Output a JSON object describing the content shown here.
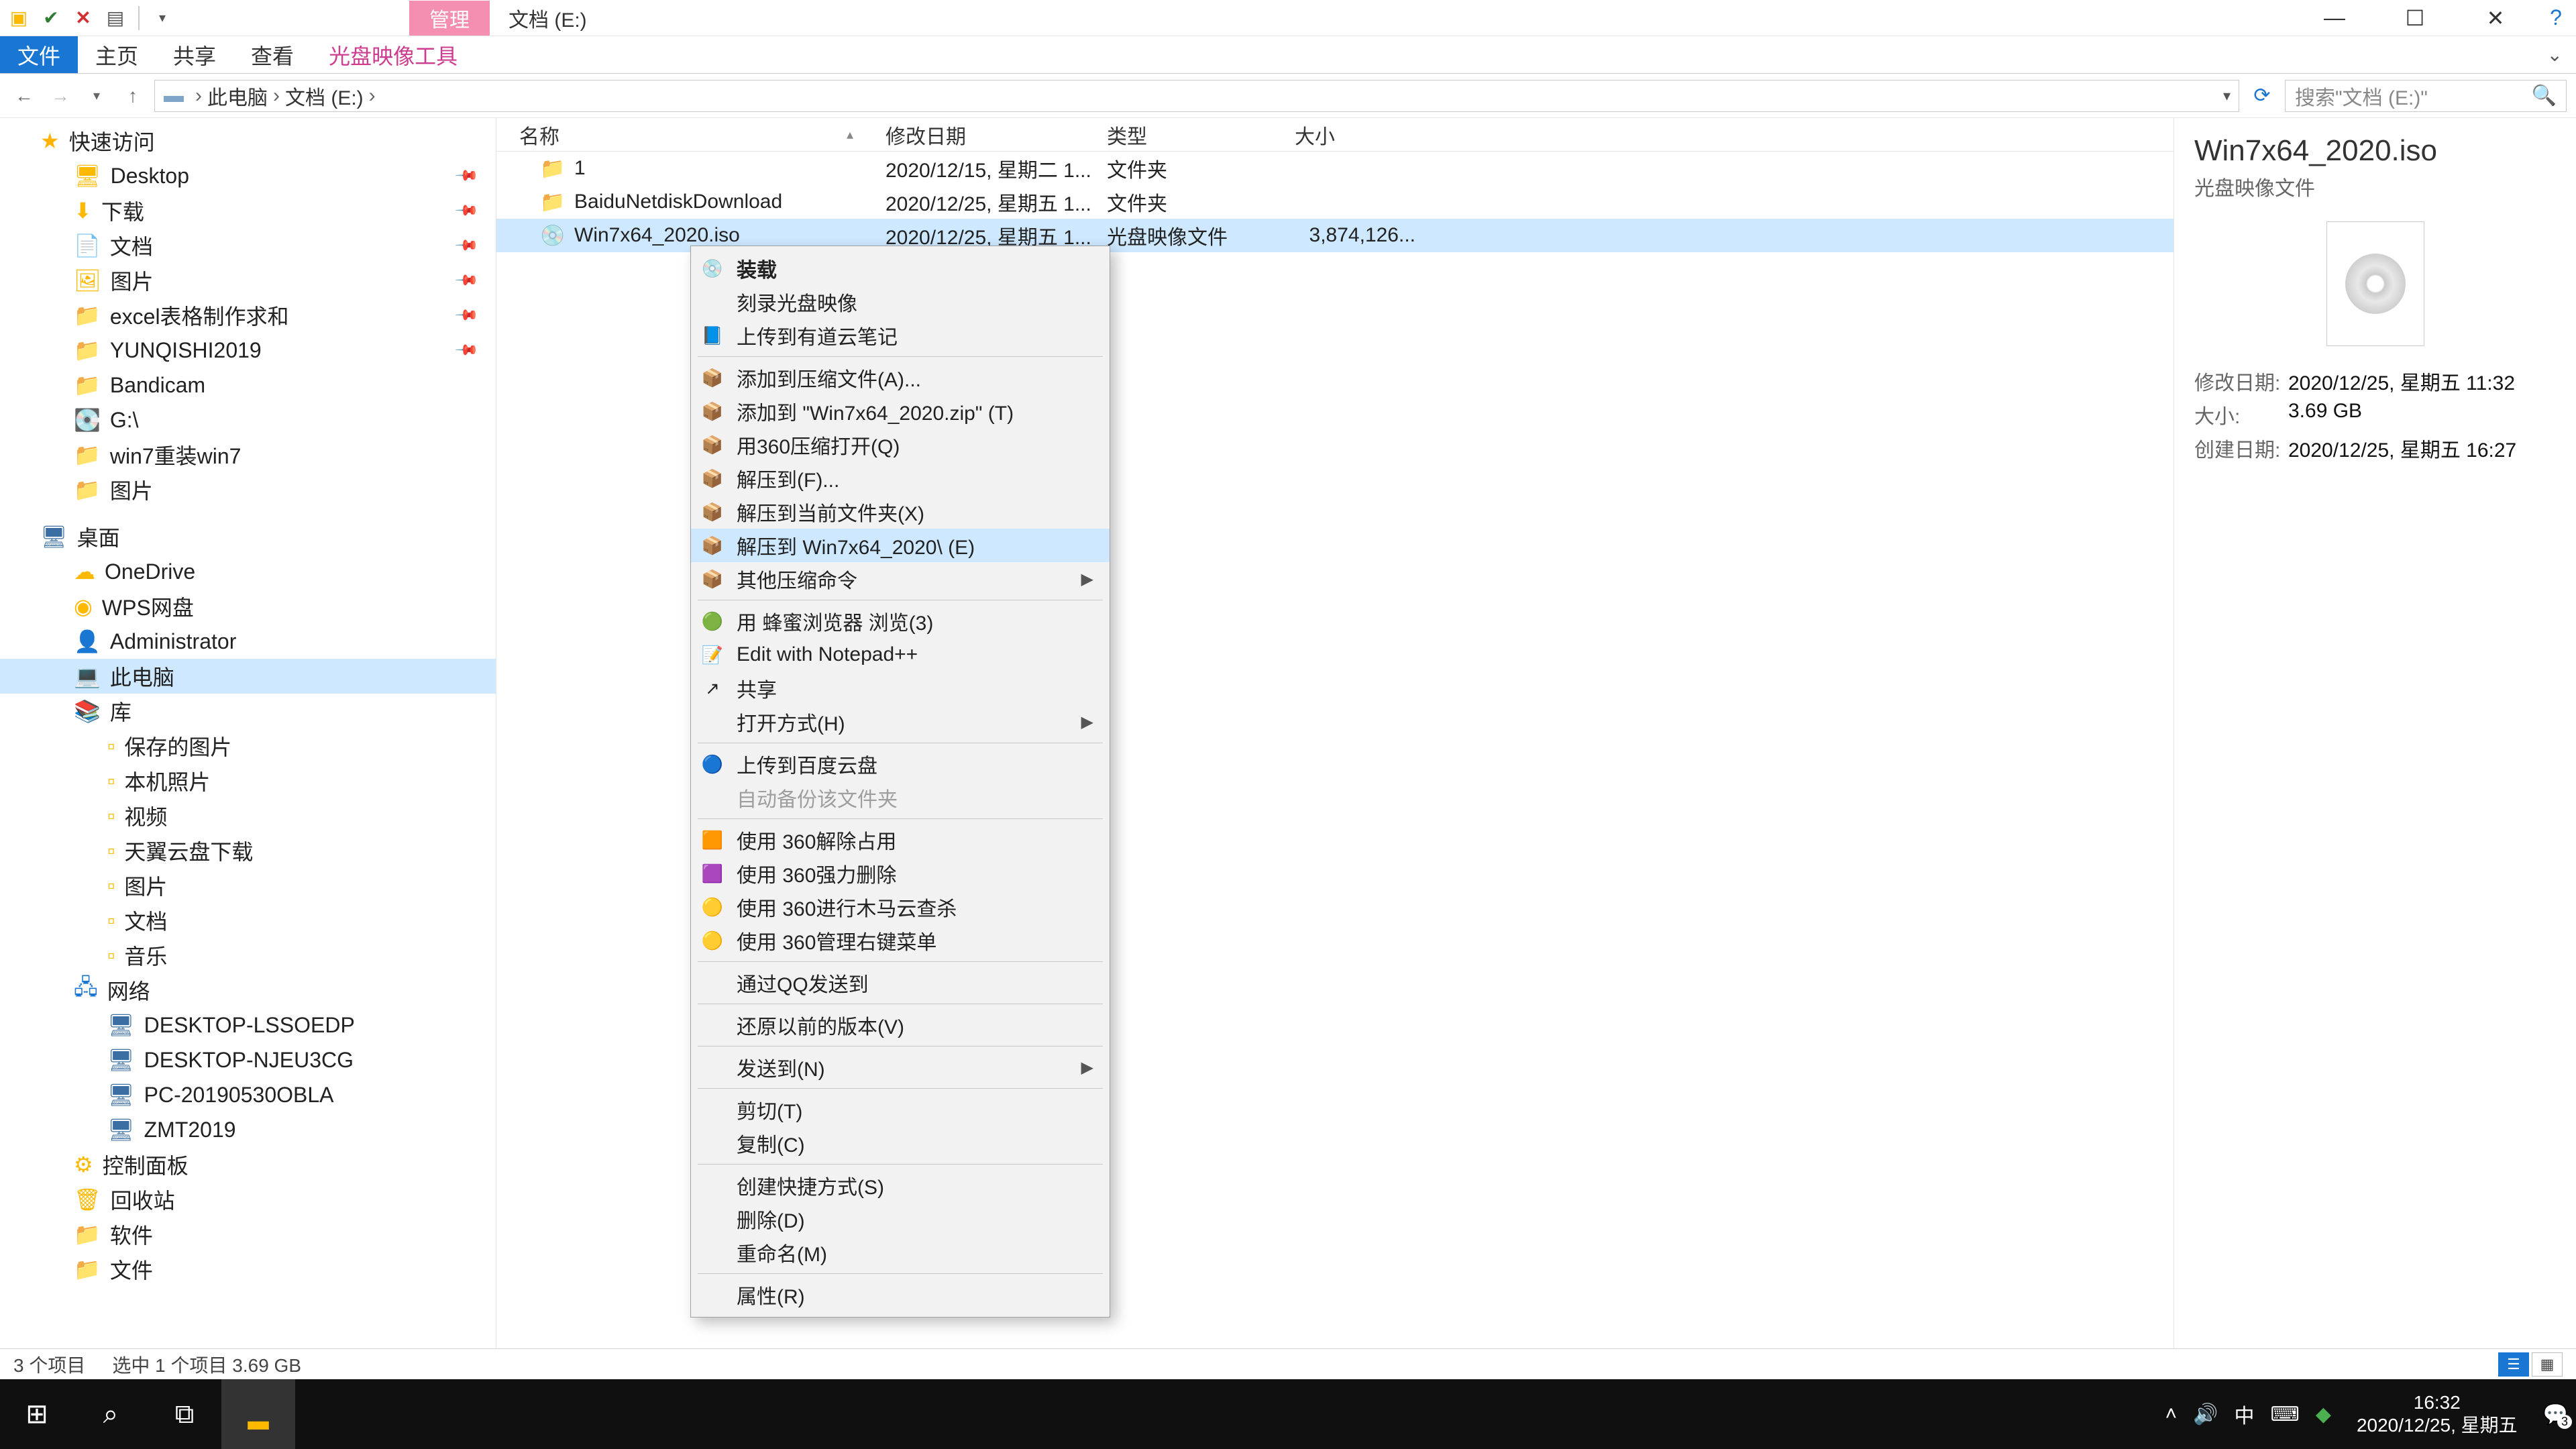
{
  "window": {
    "contextual_tab": "管理",
    "title": "文档 (E:)",
    "ribbon": {
      "file": "文件",
      "home": "主页",
      "share": "共享",
      "view": "查看",
      "disc_tool": "光盘映像工具"
    }
  },
  "qat_icons": [
    "folder-icon",
    "check-icon",
    "x-icon",
    "page-icon",
    "dropdown-icon"
  ],
  "breadcrumb": {
    "parts": [
      "此电脑",
      "文档 (E:)"
    ]
  },
  "search": {
    "placeholder": "搜索\"文档 (E:)\""
  },
  "tree": {
    "quick_access": "快速访问",
    "items_quick": [
      {
        "label": "Desktop",
        "icon": "desktop",
        "pin": true
      },
      {
        "label": "下载",
        "icon": "download",
        "pin": true
      },
      {
        "label": "文档",
        "icon": "docs",
        "pin": true
      },
      {
        "label": "图片",
        "icon": "pictures",
        "pin": true
      },
      {
        "label": "excel表格制作求和",
        "icon": "folder",
        "pin": true
      },
      {
        "label": "YUNQISHI2019",
        "icon": "folder",
        "pin": true
      },
      {
        "label": "Bandicam",
        "icon": "folder"
      },
      {
        "label": "G:\\",
        "icon": "drive"
      },
      {
        "label": "win7重装win7",
        "icon": "folder"
      },
      {
        "label": "图片",
        "icon": "folder"
      }
    ],
    "desktop": "桌面",
    "items_desktop": [
      {
        "label": "OneDrive",
        "icon": "cloud"
      },
      {
        "label": "WPS网盘",
        "icon": "wps"
      },
      {
        "label": "Administrator",
        "icon": "user"
      },
      {
        "label": "此电脑",
        "icon": "pc",
        "selected": true
      },
      {
        "label": "库",
        "icon": "library"
      }
    ],
    "items_lib": [
      {
        "label": "保存的图片"
      },
      {
        "label": "本机照片"
      },
      {
        "label": "视频"
      },
      {
        "label": "天翼云盘下载"
      },
      {
        "label": "图片"
      },
      {
        "label": "文档"
      },
      {
        "label": "音乐"
      }
    ],
    "network": "网络",
    "items_net": [
      {
        "label": "DESKTOP-LSSOEDP"
      },
      {
        "label": "DESKTOP-NJEU3CG"
      },
      {
        "label": "PC-20190530OBLA"
      },
      {
        "label": "ZMT2019"
      }
    ],
    "rest": [
      {
        "label": "控制面板",
        "icon": "cpanel"
      },
      {
        "label": "回收站",
        "icon": "recycle"
      },
      {
        "label": "软件",
        "icon": "folder"
      },
      {
        "label": "文件",
        "icon": "folder"
      }
    ]
  },
  "columns": {
    "name": "名称",
    "date": "修改日期",
    "type": "类型",
    "size": "大小"
  },
  "files": [
    {
      "name": "1",
      "date": "2020/12/15, 星期二 1...",
      "type": "文件夹",
      "size": "",
      "icon": "folder"
    },
    {
      "name": "BaiduNetdiskDownload",
      "date": "2020/12/25, 星期五 1...",
      "type": "文件夹",
      "size": "",
      "icon": "folder"
    },
    {
      "name": "Win7x64_2020.iso",
      "date": "2020/12/25, 星期五 1...",
      "type": "光盘映像文件",
      "size": "3,874,126...",
      "icon": "iso",
      "selected": true
    }
  ],
  "context_menu": [
    {
      "label": "装载",
      "bold": true,
      "icon": "disc"
    },
    {
      "label": "刻录光盘映像"
    },
    {
      "label": "上传到有道云笔记",
      "icon": "note-blue"
    },
    {
      "sep": true
    },
    {
      "label": "添加到压缩文件(A)...",
      "icon": "archive"
    },
    {
      "label": "添加到 \"Win7x64_2020.zip\" (T)",
      "icon": "archive"
    },
    {
      "label": "用360压缩打开(Q)",
      "icon": "archive"
    },
    {
      "label": "解压到(F)...",
      "icon": "archive"
    },
    {
      "label": "解压到当前文件夹(X)",
      "icon": "archive"
    },
    {
      "label": "解压到 Win7x64_2020\\ (E)",
      "icon": "archive",
      "hover": true
    },
    {
      "label": "其他压缩命令",
      "icon": "archive",
      "sub": true
    },
    {
      "sep": true
    },
    {
      "label": "用 蜂蜜浏览器 浏览(3)",
      "icon": "green-dot"
    },
    {
      "label": "Edit with Notepad++",
      "icon": "npp"
    },
    {
      "label": "共享",
      "icon": "share"
    },
    {
      "label": "打开方式(H)",
      "sub": true
    },
    {
      "sep": true
    },
    {
      "label": "上传到百度云盘",
      "icon": "baidu"
    },
    {
      "label": "自动备份该文件夹",
      "disabled": true
    },
    {
      "sep": true
    },
    {
      "label": "使用 360解除占用",
      "icon": "sq-orange"
    },
    {
      "label": "使用 360强力删除",
      "icon": "sq-purple"
    },
    {
      "label": "使用 360进行木马云查杀",
      "icon": "round-yellow"
    },
    {
      "label": "使用 360管理右键菜单",
      "icon": "round-yellow"
    },
    {
      "sep": true
    },
    {
      "label": "通过QQ发送到"
    },
    {
      "sep": true
    },
    {
      "label": "还原以前的版本(V)"
    },
    {
      "sep": true
    },
    {
      "label": "发送到(N)",
      "sub": true
    },
    {
      "sep": true
    },
    {
      "label": "剪切(T)"
    },
    {
      "label": "复制(C)"
    },
    {
      "sep": true
    },
    {
      "label": "创建快捷方式(S)"
    },
    {
      "label": "删除(D)"
    },
    {
      "label": "重命名(M)"
    },
    {
      "sep": true
    },
    {
      "label": "属性(R)"
    }
  ],
  "details": {
    "title": "Win7x64_2020.iso",
    "type": "光盘映像文件",
    "rows": [
      {
        "k": "修改日期:",
        "v": "2020/12/25, 星期五 11:32"
      },
      {
        "k": "大小:",
        "v": "3.69 GB"
      },
      {
        "k": "创建日期:",
        "v": "2020/12/25, 星期五 16:27"
      }
    ]
  },
  "status": {
    "count": "3 个项目",
    "sel": "选中 1 个项目  3.69 GB"
  },
  "taskbar": {
    "time": "16:32",
    "date": "2020/12/25, 星期五",
    "ime": "中",
    "badge": "3"
  }
}
